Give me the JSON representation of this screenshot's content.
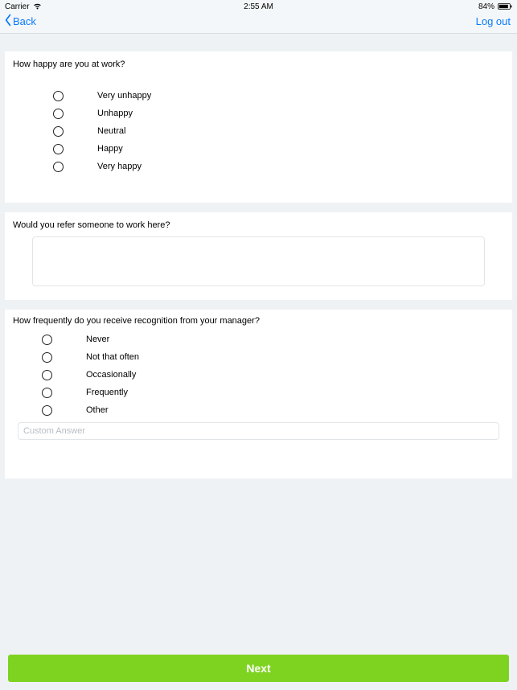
{
  "status": {
    "carrier": "Carrier",
    "time": "2:55 AM",
    "battery": "84%"
  },
  "nav": {
    "back": "Back",
    "logout": "Log out"
  },
  "q1": {
    "question": "How happy are you at work?",
    "options": [
      "Very unhappy",
      "Unhappy",
      "Neutral",
      "Happy",
      "Very happy"
    ]
  },
  "q2": {
    "question": "Would you refer someone to work here?",
    "value": ""
  },
  "q3": {
    "question": "How frequently do you receive recognition from your manager?",
    "options": [
      "Never",
      "Not that often",
      "Occasionally",
      "Frequently",
      "Other"
    ],
    "custom_placeholder": "Custom Answer",
    "custom_value": ""
  },
  "next": "Next"
}
